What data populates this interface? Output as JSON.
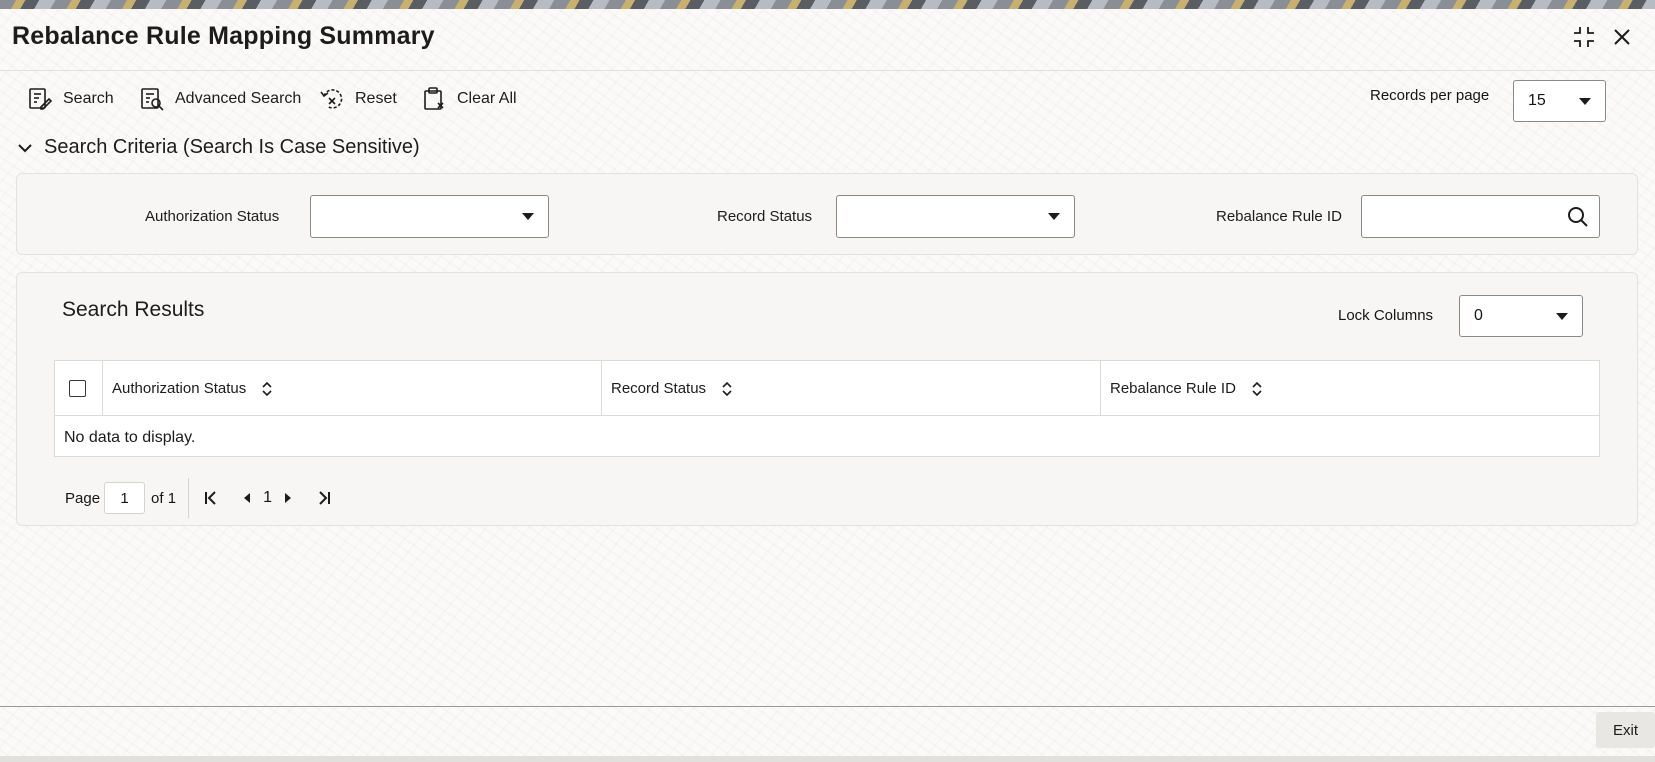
{
  "window": {
    "title": "Rebalance Rule Mapping Summary"
  },
  "toolbar": {
    "search_label": "Search",
    "advanced_search_label": "Advanced Search",
    "reset_label": "Reset",
    "clear_all_label": "Clear All",
    "records_per_page_label": "Records per page",
    "records_per_page_value": "15"
  },
  "criteria": {
    "heading": "Search Criteria (Search Is Case Sensitive)",
    "authorization_status_label": "Authorization Status",
    "authorization_status_value": "",
    "record_status_label": "Record Status",
    "record_status_value": "",
    "rebalance_rule_id_label": "Rebalance Rule ID",
    "rebalance_rule_id_value": ""
  },
  "results": {
    "title": "Search Results",
    "lock_columns_label": "Lock Columns",
    "lock_columns_value": "0",
    "columns": [
      "Authorization Status",
      "Record Status",
      "Rebalance Rule ID"
    ],
    "empty_message": "No data to display."
  },
  "pagination": {
    "page_label": "Page",
    "current_page": "1",
    "of_label": "of 1",
    "page_number": "1"
  },
  "footer": {
    "exit_label": "Exit"
  }
}
